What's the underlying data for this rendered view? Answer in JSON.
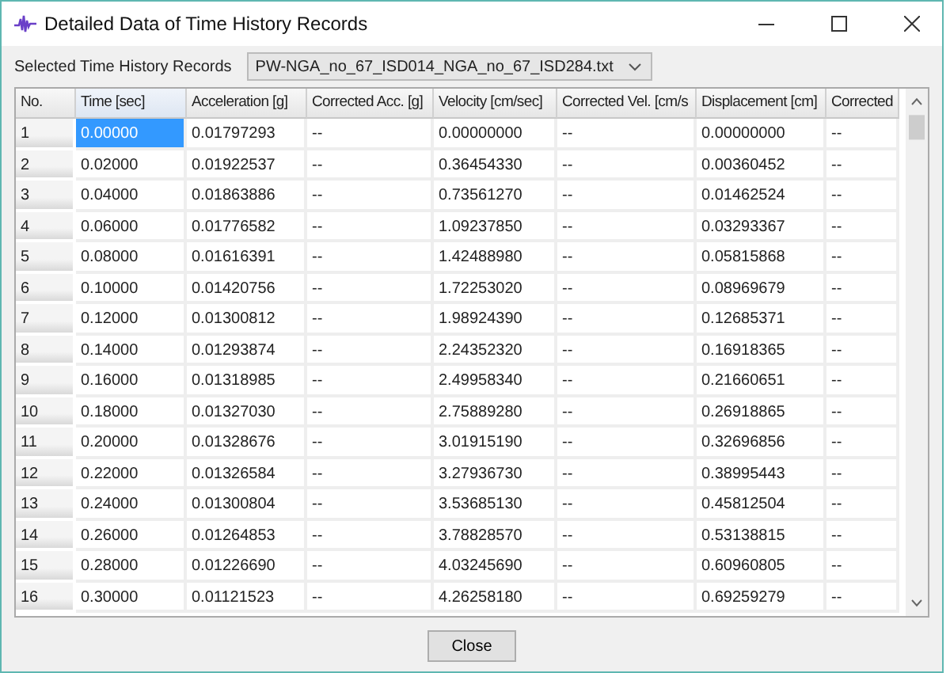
{
  "window": {
    "title": "Detailed Data of Time History Records"
  },
  "record_selector": {
    "label": "Selected Time History Records",
    "value": "PW-NGA_no_67_ISD014_NGA_no_67_ISD284.txt"
  },
  "table": {
    "columns": [
      {
        "label": "No.",
        "selected": false
      },
      {
        "label": "Time [sec]",
        "selected": true
      },
      {
        "label": "Acceleration [g]",
        "selected": false
      },
      {
        "label": "Corrected Acc. [g]",
        "selected": false
      },
      {
        "label": "Velocity [cm/sec]",
        "selected": false
      },
      {
        "label": "Corrected Vel. [cm/s",
        "selected": false
      },
      {
        "label": "Displacement [cm]",
        "selected": false
      },
      {
        "label": "Corrected",
        "selected": false
      }
    ],
    "rows": [
      {
        "selected": true,
        "cells": [
          "1",
          "0.00000",
          "0.01797293",
          "--",
          "0.00000000",
          "--",
          "0.00000000",
          "--"
        ]
      },
      {
        "selected": false,
        "cells": [
          "2",
          "0.02000",
          "0.01922537",
          "--",
          "0.36454330",
          "--",
          "0.00360452",
          "--"
        ]
      },
      {
        "selected": false,
        "cells": [
          "3",
          "0.04000",
          "0.01863886",
          "--",
          "0.73561270",
          "--",
          "0.01462524",
          "--"
        ]
      },
      {
        "selected": false,
        "cells": [
          "4",
          "0.06000",
          "0.01776582",
          "--",
          "1.09237850",
          "--",
          "0.03293367",
          "--"
        ]
      },
      {
        "selected": false,
        "cells": [
          "5",
          "0.08000",
          "0.01616391",
          "--",
          "1.42488980",
          "--",
          "0.05815868",
          "--"
        ]
      },
      {
        "selected": false,
        "cells": [
          "6",
          "0.10000",
          "0.01420756",
          "--",
          "1.72253020",
          "--",
          "0.08969679",
          "--"
        ]
      },
      {
        "selected": false,
        "cells": [
          "7",
          "0.12000",
          "0.01300812",
          "--",
          "1.98924390",
          "--",
          "0.12685371",
          "--"
        ]
      },
      {
        "selected": false,
        "cells": [
          "8",
          "0.14000",
          "0.01293874",
          "--",
          "2.24352320",
          "--",
          "0.16918365",
          "--"
        ]
      },
      {
        "selected": false,
        "cells": [
          "9",
          "0.16000",
          "0.01318985",
          "--",
          "2.49958340",
          "--",
          "0.21660651",
          "--"
        ]
      },
      {
        "selected": false,
        "cells": [
          "10",
          "0.18000",
          "0.01327030",
          "--",
          "2.75889280",
          "--",
          "0.26918865",
          "--"
        ]
      },
      {
        "selected": false,
        "cells": [
          "11",
          "0.20000",
          "0.01328676",
          "--",
          "3.01915190",
          "--",
          "0.32696856",
          "--"
        ]
      },
      {
        "selected": false,
        "cells": [
          "12",
          "0.22000",
          "0.01326584",
          "--",
          "3.27936730",
          "--",
          "0.38995443",
          "--"
        ]
      },
      {
        "selected": false,
        "cells": [
          "13",
          "0.24000",
          "0.01300804",
          "--",
          "3.53685130",
          "--",
          "0.45812504",
          "--"
        ]
      },
      {
        "selected": false,
        "cells": [
          "14",
          "0.26000",
          "0.01264853",
          "--",
          "3.78828570",
          "--",
          "0.53138815",
          "--"
        ]
      },
      {
        "selected": false,
        "cells": [
          "15",
          "0.28000",
          "0.01226690",
          "--",
          "4.03245690",
          "--",
          "0.60960805",
          "--"
        ]
      },
      {
        "selected": false,
        "cells": [
          "16",
          "0.30000",
          "0.01121523",
          "--",
          "4.26258180",
          "--",
          "0.69259279",
          "--"
        ]
      }
    ]
  },
  "buttons": [
    "Close"
  ]
}
